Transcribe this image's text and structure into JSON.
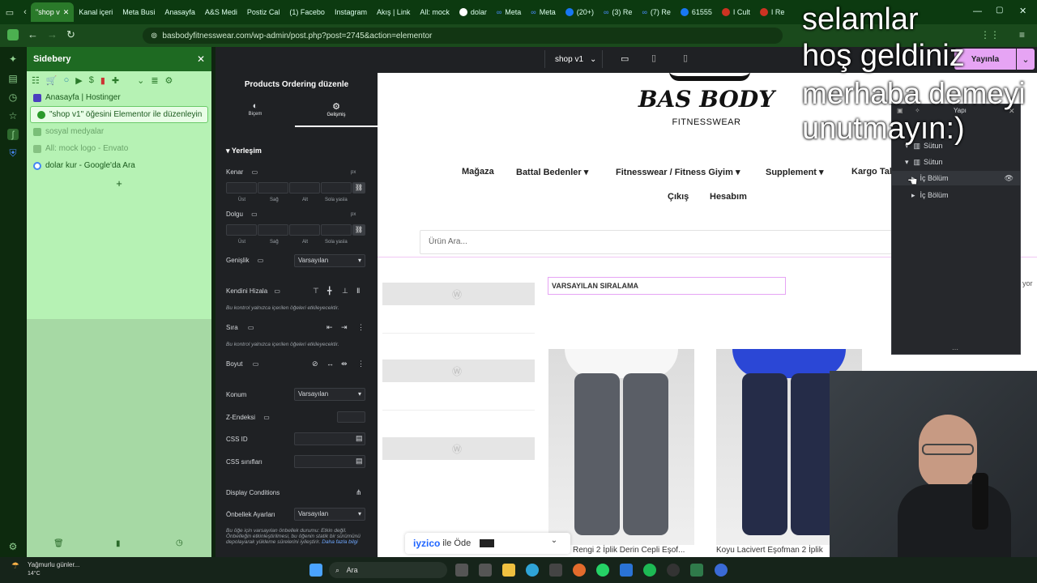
{
  "browser": {
    "tabs": [
      {
        "label": "\"shop v",
        "active": true
      },
      {
        "label": "Kanal içeri"
      },
      {
        "label": "Meta Busi"
      },
      {
        "label": "Anasayfa"
      },
      {
        "label": "A&S Medi"
      },
      {
        "label": "Postiz Cal"
      },
      {
        "label": "(1) Facebo"
      },
      {
        "label": "Instagram"
      },
      {
        "label": "Akış | Link"
      },
      {
        "label": "All: mock"
      },
      {
        "label": "dolar"
      },
      {
        "label": "Meta"
      },
      {
        "label": "Meta"
      },
      {
        "label": "(20+)"
      },
      {
        "label": "(3) Re"
      },
      {
        "label": "(7) Re"
      },
      {
        "label": "61555"
      },
      {
        "label": "I Cult"
      },
      {
        "label": "I Re"
      }
    ],
    "url": "basbodyfitnesswear.com/wp-admin/post.php?post=2745&action=elementor"
  },
  "sidebery": {
    "title": "Sidebery",
    "items": [
      {
        "label": "Anasayfa | Hostinger",
        "style": "normal"
      },
      {
        "label": "\"shop v1\" öğesini Elementor ile düzenleyin",
        "style": "selected"
      },
      {
        "label": "sosyal medyalar",
        "style": "muted"
      },
      {
        "label": "All: mock logo - Envato",
        "style": "muted"
      },
      {
        "label": "dolar kur - Google'da Ara",
        "style": "normal"
      }
    ],
    "add_label": "+"
  },
  "elementor": {
    "page_select": "shop v1",
    "publish": "Yayınla",
    "panel_title": "Products Ordering düzenle",
    "tabs": [
      "Biçem",
      "Gelişmiş"
    ],
    "section": "Yerleşim",
    "margin_label": "Kenar",
    "padding_label": "Dolgu",
    "unit": "px",
    "sides": [
      "Üst",
      "Sağ",
      "Alt",
      "Sola yasla"
    ],
    "width_label": "Genişlik",
    "width_value": "Varsayılan",
    "align_self_label": "Kendini Hizala",
    "align_note": "Bu kontrol yalnızca içerilen öğeleri etkileyecektir.",
    "order_label": "Sıra",
    "order_note": "Bu kontrol yalnızca içerilen öğeleri etkileyecektir.",
    "size_label": "Boyut",
    "position_label": "Konum",
    "position_value": "Varsayılan",
    "zindex_label": "Z-Endeksi",
    "cssid_label": "CSS ID",
    "cssclass_label": "CSS sınıfları",
    "display_cond_label": "Display Conditions",
    "cache_label": "Önbellek Ayarları",
    "cache_value": "Varsayılan",
    "cache_note": "Bu öğe için varsayılan önbellek durumu: Etkin değil. Önbelleğin etkinleştirilmesi, bu öğenin statik bir sürümünü depolayarak yükleme sürelerini iyileştirir.",
    "more_link": "Daha fazla bilgi"
  },
  "site": {
    "logo_top": "BAS BODY",
    "logo_sub": "FITNESSWEAR",
    "nav": [
      "Mağaza",
      "Battal Bedenler",
      "Fitnesswear / Fitness Giyim",
      "Supplement",
      "Kargo Takip",
      "Çıkış",
      "Hesabım"
    ],
    "search_placeholder": "Ürün Ara...",
    "ordering": "VARSAYILAN SIRALAMA",
    "side_text": "yor",
    "products": [
      {
        "name": "Rengi 2 İplik Derin Cepli Eşof...",
        "color": "#5a5e66"
      },
      {
        "name": "Koyu Lacivert Eşofman 2 İplik",
        "color": "#252c48"
      }
    ],
    "payment": "iyzico",
    "payment_suffix": "ile Öde"
  },
  "structure": {
    "title": "Yapı",
    "rows": [
      {
        "label": "Sütun",
        "indent": 1
      },
      {
        "label": "Sütun",
        "indent": 1
      },
      {
        "label": "İç Bölüm",
        "indent": 2
      },
      {
        "label": "İç Bölüm",
        "indent": 2
      }
    ]
  },
  "overlay": {
    "line1": "selamlar",
    "line2": "hoş geldiniz",
    "line3": "merhaba demeyi",
    "line4": "unutmayın:)"
  },
  "taskbar": {
    "weather": "Yağmurlu günler...",
    "temp": "14°C",
    "search": "Ara"
  }
}
